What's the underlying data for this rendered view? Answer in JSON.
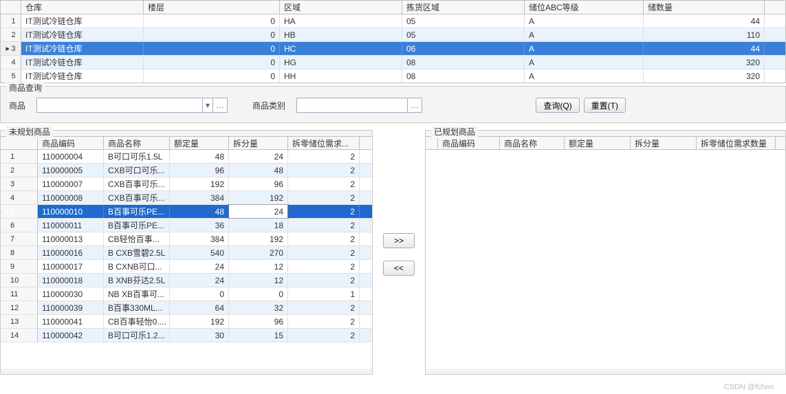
{
  "topGrid": {
    "headers": {
      "warehouse": "仓库",
      "floor": "楼层",
      "area": "区域",
      "pick": "拣货区域",
      "grade": "储位ABC等级",
      "qty": "储数量"
    },
    "selectedIndex": 2,
    "rows": [
      {
        "warehouse": "IT测试冷链仓库",
        "floor": 0,
        "area": "HA",
        "pick": "05",
        "grade": "A",
        "qty": 44
      },
      {
        "warehouse": "IT测试冷链仓库",
        "floor": 0,
        "area": "HB",
        "pick": "05",
        "grade": "A",
        "qty": 110
      },
      {
        "warehouse": "IT测试冷链仓库",
        "floor": 0,
        "area": "HC",
        "pick": "06",
        "grade": "A",
        "qty": 44
      },
      {
        "warehouse": "IT测试冷链仓库",
        "floor": 0,
        "area": "HG",
        "pick": "08",
        "grade": "A",
        "qty": 320
      },
      {
        "warehouse": "IT测试冷链仓库",
        "floor": 0,
        "area": "HH",
        "pick": "08",
        "grade": "A",
        "qty": 320
      }
    ]
  },
  "queryGroup": {
    "title": "商品查询",
    "productLabel": "商品",
    "categoryLabel": "商品类别",
    "queryBtn": "查询(Q)",
    "resetBtn": "重置(T)"
  },
  "leftPanel": {
    "title": "未规划商品",
    "headers": {
      "code": "商品编码",
      "name": "商品名称",
      "q1": "额定量",
      "q2": "拆分量",
      "q3": "拆零储位需求..."
    },
    "selectedIndex": 4,
    "rows": [
      {
        "code": "110000004",
        "name": "B可口可乐1.5L",
        "q1": 48,
        "q2": 24,
        "q3": 2
      },
      {
        "code": "110000005",
        "name": "CXB可口可乐...",
        "q1": 96,
        "q2": 48,
        "q3": 2
      },
      {
        "code": "110000007",
        "name": "CXB百事可乐...",
        "q1": 192,
        "q2": 96,
        "q3": 2
      },
      {
        "code": "110000008",
        "name": "CXB百事可乐...",
        "q1": 384,
        "q2": 192,
        "q3": 2
      },
      {
        "code": "110000010",
        "name": "B百事可乐PE...",
        "q1": 48,
        "q2": 24,
        "q3": 2
      },
      {
        "code": "110000011",
        "name": "B百事可乐PE...",
        "q1": 36,
        "q2": 18,
        "q3": 2
      },
      {
        "code": "110000013",
        "name": "CB轻怡百事...",
        "q1": 384,
        "q2": 192,
        "q3": 2
      },
      {
        "code": "110000016",
        "name": "B CXB雪碧2.5L",
        "q1": 540,
        "q2": 270,
        "q3": 2
      },
      {
        "code": "110000017",
        "name": "B CXNB可口...",
        "q1": 24,
        "q2": 12,
        "q3": 2
      },
      {
        "code": "110000018",
        "name": "B XNB芬达2.5L",
        "q1": 24,
        "q2": 12,
        "q3": 2
      },
      {
        "code": "110000030",
        "name": "NB XB百事可...",
        "q1": 0,
        "q2": 0,
        "q3": 1
      },
      {
        "code": "110000039",
        "name": "B百事330ML...",
        "q1": 64,
        "q2": 32,
        "q3": 2
      },
      {
        "code": "110000041",
        "name": "CB百事轻怡0....",
        "q1": 192,
        "q2": 96,
        "q3": 2
      },
      {
        "code": "110000042",
        "name": "B可口可乐1.2...",
        "q1": 30,
        "q2": 15,
        "q3": 2
      }
    ]
  },
  "rightPanel": {
    "title": "已规划商品",
    "headers": {
      "code": "商品编码",
      "name": "商品名称",
      "q1": "额定量",
      "q2": "拆分量",
      "q3": "拆零储位需求数量"
    },
    "rows": []
  },
  "midButtons": {
    "add": ">>",
    "remove": "<<"
  },
  "watermark": "CSDN @fchen"
}
